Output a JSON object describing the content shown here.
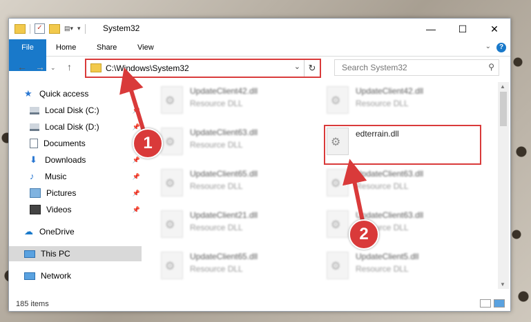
{
  "window": {
    "title": "System32",
    "controls": {
      "minimize": "—",
      "maximize": "☐",
      "close": "✕"
    }
  },
  "ribbon": {
    "tabs": [
      "File",
      "Home",
      "Share",
      "View"
    ]
  },
  "address": {
    "path": "C:\\Windows\\System32",
    "search_placeholder": "Search System32"
  },
  "nav": {
    "items": [
      {
        "label": "Quick access",
        "icon": "star-icon"
      },
      {
        "label": "Local Disk (C:)",
        "icon": "drive-icon"
      },
      {
        "label": "Local Disk (D:)",
        "icon": "drive-icon"
      },
      {
        "label": "Documents",
        "icon": "documents-icon"
      },
      {
        "label": "Downloads",
        "icon": "download-icon"
      },
      {
        "label": "Music",
        "icon": "music-icon"
      },
      {
        "label": "Pictures",
        "icon": "pictures-icon"
      },
      {
        "label": "Videos",
        "icon": "videos-icon"
      },
      {
        "label": "OneDrive",
        "icon": "cloud-icon"
      },
      {
        "label": "This PC",
        "icon": "computer-icon"
      },
      {
        "label": "Network",
        "icon": "network-icon"
      }
    ]
  },
  "files": {
    "col1": [
      {
        "name": "UpdateClient42.dll",
        "type": "Resource DLL"
      },
      {
        "name": "UpdateClient63.dll",
        "type": "Resource DLL"
      },
      {
        "name": "UpdateClient65.dll",
        "type": "Resource DLL"
      },
      {
        "name": "UpdateClient21.dll",
        "type": "Resource DLL"
      },
      {
        "name": "UpdateClient65.dll",
        "type": "Resource DLL"
      }
    ],
    "col2": [
      {
        "name": "UpdateClient42.dll",
        "type": "Resource DLL"
      },
      {
        "name": "edterrain.dll",
        "type": ""
      },
      {
        "name": "UpdateClient63.dll",
        "type": "Resource DLL"
      },
      {
        "name": "UpdateClient63.dll",
        "type": "Resource DLL"
      },
      {
        "name": "UpdateClient5.dll",
        "type": "Resource DLL"
      }
    ]
  },
  "status": {
    "item_count": "185 items"
  },
  "annotations": {
    "step1": "1",
    "step2": "2",
    "color": "#d93a3a"
  }
}
